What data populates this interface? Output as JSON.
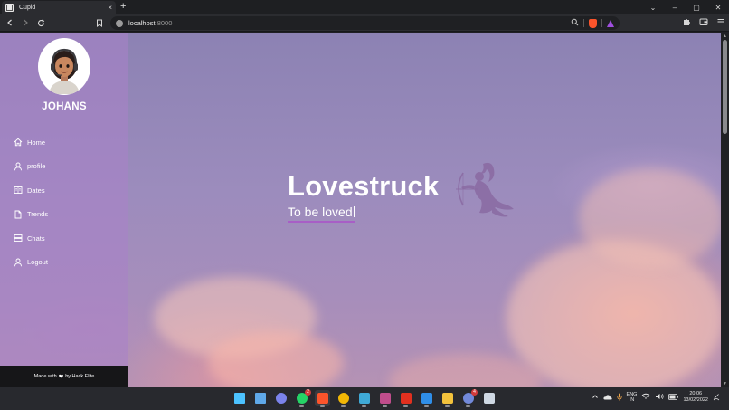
{
  "browser": {
    "tab_title": "Cupid",
    "new_tab_symbol": "+",
    "tab_close_symbol": "×",
    "url_host": "localhost",
    "url_port": ":8000",
    "window_controls": [
      "⌄",
      "–",
      "▢",
      "✕"
    ],
    "icons": [
      "back-icon",
      "forward-icon",
      "reload-icon",
      "bookmark-icon",
      "zoom-icon",
      "brave-shields-icon",
      "brave-rewards-icon",
      "extensions-icon",
      "wallet-icon",
      "menu-icon"
    ]
  },
  "sidebar": {
    "username": "JOHANS",
    "nav": [
      {
        "label": "Home",
        "icon": "home-icon"
      },
      {
        "label": "profile",
        "icon": "user-icon"
      },
      {
        "label": "Dates",
        "icon": "book-icon"
      },
      {
        "label": "Trends",
        "icon": "document-icon"
      },
      {
        "label": "Chats",
        "icon": "server-icon"
      },
      {
        "label": "Logout",
        "icon": "logout-user-icon"
      }
    ],
    "footer": {
      "before": "Made with",
      "after": "by Hack Elite",
      "icon": "heart-icon"
    }
  },
  "hero": {
    "title": "Lovestruck",
    "subtitle": "To be loved"
  },
  "colors": {
    "sidebar_overlay": "#aa82c8",
    "underline": "#a85ec6",
    "cupid": "#8a6aa2",
    "footer_bg": "#161618"
  },
  "taskbar": {
    "apps": [
      {
        "icon": "windows-start-icon",
        "color": "#4cc2ff"
      },
      {
        "icon": "widgets-icon",
        "color": "#5fa8e8"
      },
      {
        "icon": "teams-chat-icon",
        "color": "#7b83eb"
      },
      {
        "icon": "whatsapp-icon",
        "color": "#25d366",
        "badge": "2"
      },
      {
        "icon": "brave-icon",
        "color": "#fb542b"
      },
      {
        "icon": "chrome-icon",
        "color": "#f2b705"
      },
      {
        "icon": "notepad-icon",
        "color": "#3fa9d6"
      },
      {
        "icon": "winrar-icon",
        "color": "#c04d8c"
      },
      {
        "icon": "acrobat-icon",
        "color": "#e2301f"
      },
      {
        "icon": "vscode-icon",
        "color": "#2f8ee8"
      },
      {
        "icon": "file-explorer-icon",
        "color": "#f3c23c"
      },
      {
        "icon": "discord-icon",
        "color": "#7289da",
        "badge": "4"
      },
      {
        "icon": "app-icon",
        "color": "#cfd8e3"
      }
    ],
    "tray": {
      "lang_line1": "ENG",
      "lang_line2": "IN",
      "time": "20:06",
      "date": "13/02/2022"
    }
  }
}
